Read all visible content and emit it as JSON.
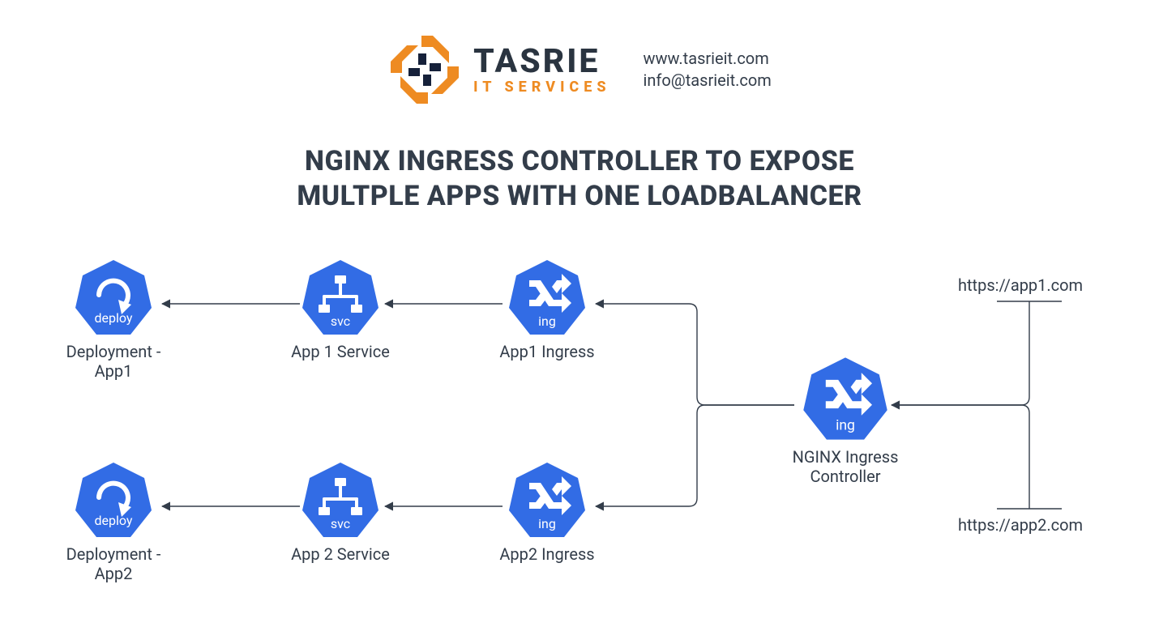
{
  "brand": {
    "name": "TASRIE",
    "tagline": "IT SERVICES",
    "website": "www.tasrieit.com",
    "email": "info@tasrieit.com"
  },
  "title": "NGINX INGRESS CONTROLLER TO EXPOSE\nMULTPLE APPS WITH ONE LOADBALANCER",
  "nodes": {
    "deploy1": {
      "label": "Deployment -\nApp1",
      "tag": "deploy"
    },
    "svc1": {
      "label": "App 1 Service",
      "tag": "svc"
    },
    "ing1": {
      "label": "App1 Ingress",
      "tag": "ing"
    },
    "deploy2": {
      "label": "Deployment -\nApp2",
      "tag": "deploy"
    },
    "svc2": {
      "label": "App 2 Service",
      "tag": "svc"
    },
    "ing2": {
      "label": "App2 Ingress",
      "tag": "ing"
    },
    "ctrl": {
      "label": "NGINX Ingress\nController",
      "tag": "ing"
    }
  },
  "urls": {
    "app1": "https://app1.com",
    "app2": "https://app2.com"
  },
  "colors": {
    "k8sBlue": "#326ce5",
    "brandOrange": "#ee8b22",
    "brandNavy": "#16213a",
    "text": "#333d4a"
  }
}
